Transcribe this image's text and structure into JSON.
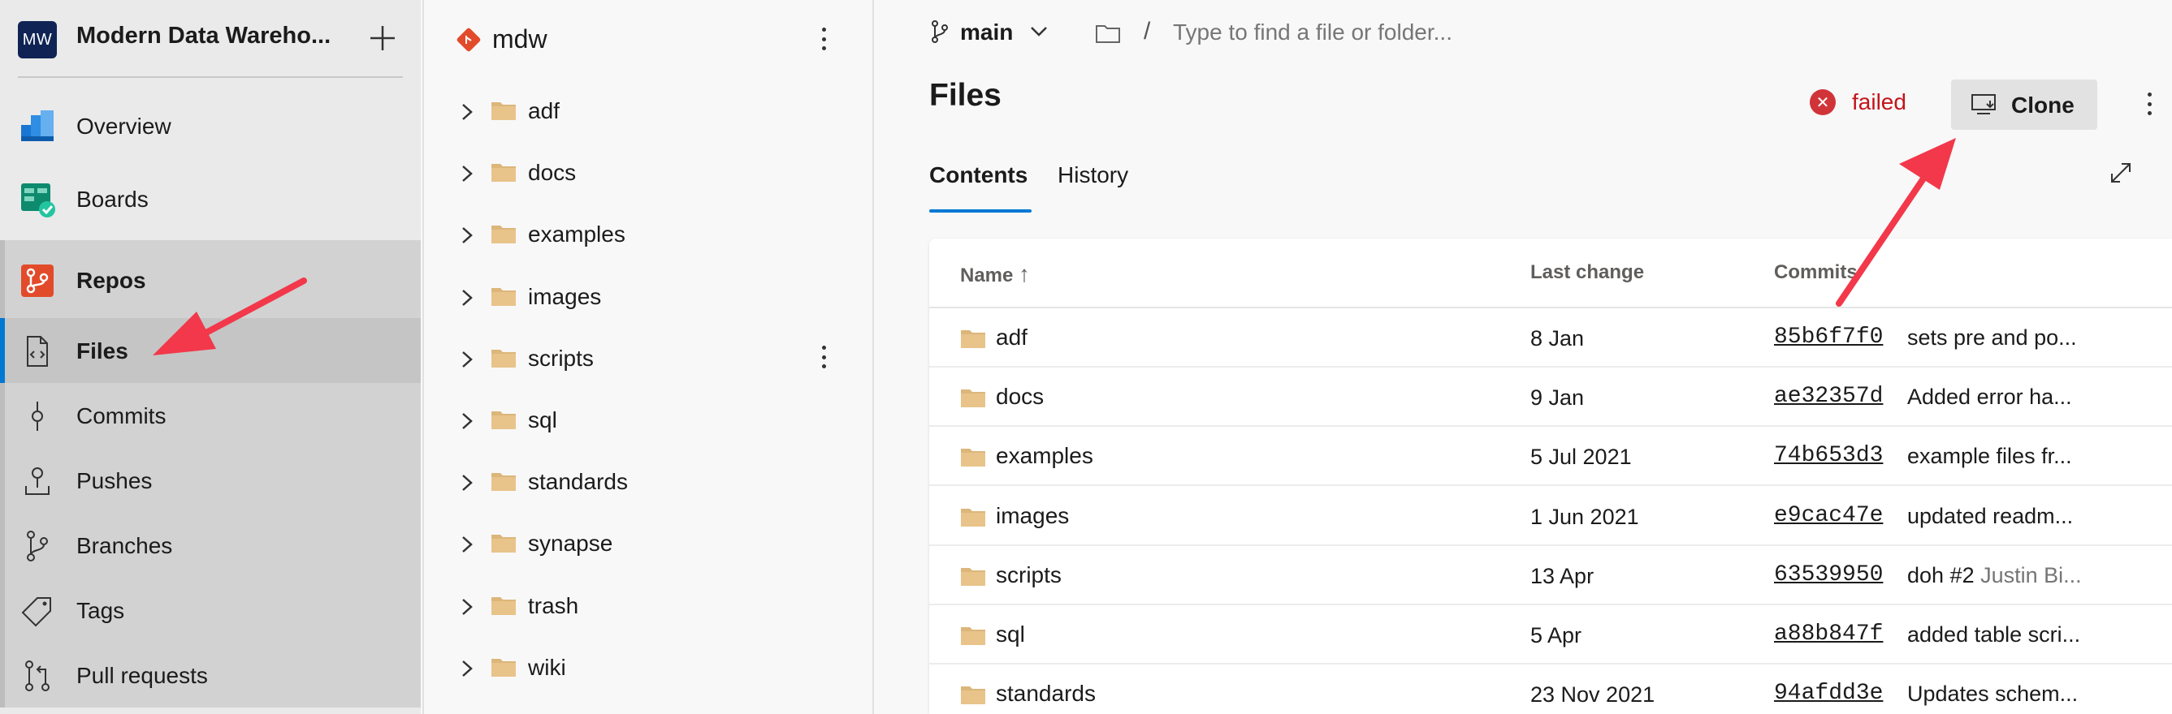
{
  "nav": {
    "project_initials": "MW",
    "project_name": "Modern Data Wareho...",
    "items": [
      {
        "label": "Overview"
      },
      {
        "label": "Boards"
      },
      {
        "label": "Repos"
      },
      {
        "label": "Files"
      },
      {
        "label": "Commits"
      },
      {
        "label": "Pushes"
      },
      {
        "label": "Branches"
      },
      {
        "label": "Tags"
      },
      {
        "label": "Pull requests"
      }
    ]
  },
  "tree": {
    "repo_name": "mdw",
    "folders": [
      "adf",
      "docs",
      "examples",
      "images",
      "scripts",
      "sql",
      "standards",
      "synapse",
      "trash",
      "wiki"
    ]
  },
  "main": {
    "branch": "main",
    "path_placeholder": "Type to find a file or folder...",
    "path_separator": "/",
    "title": "Files",
    "status_text": "failed",
    "clone_label": "Clone",
    "tabs": [
      {
        "label": "Contents"
      },
      {
        "label": "History"
      }
    ],
    "columns": {
      "name": "Name",
      "sort_arrow": "↑",
      "last_change": "Last change",
      "commits": "Commits"
    },
    "rows": [
      {
        "name": "adf",
        "last_change": "8 Jan",
        "commit": "85b6f7f0",
        "message": "sets pre and po...",
        "author": ""
      },
      {
        "name": "docs",
        "last_change": "9 Jan",
        "commit": "ae32357d",
        "message": "Added error ha...",
        "author": ""
      },
      {
        "name": "examples",
        "last_change": "5 Jul 2021",
        "commit": "74b653d3",
        "message": "example files fr...",
        "author": ""
      },
      {
        "name": "images",
        "last_change": "1 Jun 2021",
        "commit": "e9cac47e",
        "message": "updated readm...",
        "author": ""
      },
      {
        "name": "scripts",
        "last_change": "13 Apr",
        "commit": "63539950",
        "message": "doh #2",
        "author": "Justin Bi..."
      },
      {
        "name": "sql",
        "last_change": "5 Apr",
        "commit": "a88b847f",
        "message": "added table scri...",
        "author": ""
      },
      {
        "name": "standards",
        "last_change": "23 Nov 2021",
        "commit": "94afdd3e",
        "message": "Updates schem...",
        "author": ""
      }
    ]
  },
  "colors": {
    "accent": "#0078d4",
    "error": "#d13438",
    "annotation_arrow": "#f2384a",
    "folder": "#dcb67a"
  }
}
